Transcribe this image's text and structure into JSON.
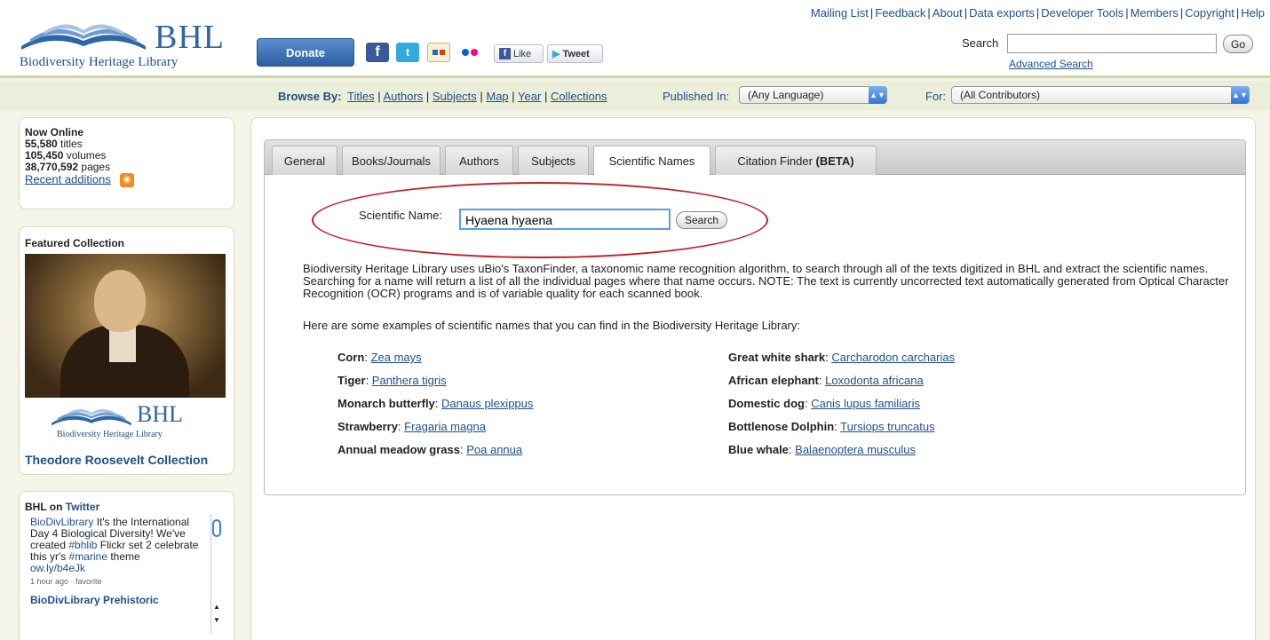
{
  "header": {
    "logo_name": "BHL",
    "logo_sub": "Biodiversity Heritage Library",
    "donate_label": "Donate",
    "like_label": "Like",
    "tweet_label": "Tweet",
    "top_links": [
      "Mailing List",
      "Feedback",
      "About",
      "Data exports",
      "Developer Tools",
      "Members",
      "Copyright",
      "Help"
    ],
    "search_label": "Search",
    "search_value": "",
    "go_label": "Go",
    "advanced_search": "Advanced Search",
    "colors": {
      "brand_blue": "#2d66a5",
      "facebook": "#3b5998",
      "twitter": "#33aadd",
      "flickr_pink": "#ff0084",
      "flickr_blue": "#0063dc"
    }
  },
  "browse": {
    "label": "Browse By:",
    "links": [
      "Titles",
      "Authors",
      "Subjects",
      "Map",
      "Year",
      "Collections"
    ],
    "published_label": "Published In:",
    "language_selected": "(Any Language)",
    "for_label": "For:",
    "contributor_selected": "(All Contributors)"
  },
  "sidebar": {
    "now_online": {
      "title": "Now Online",
      "titles_count": "55,580",
      "titles_word": "titles",
      "volumes_count": "105,450",
      "volumes_word": "volumes",
      "pages_count": "38,770,592",
      "pages_word": "pages",
      "recent_label": "Recent additions"
    },
    "featured": {
      "title": "Featured Collection",
      "collection_name": "Theodore Roosevelt Collection",
      "logo_name": "BHL",
      "logo_sub": "Biodiversity Heritage Library"
    },
    "twitter": {
      "title_prefix": "BHL on",
      "title_link": "Twitter",
      "tweet_user": "BioDivLibrary",
      "tweet_text_1": "It's the International Day 4 Biological Diversity! We've created",
      "tweet_hashtag_1": "#bhlib",
      "tweet_text_2": "Flickr set 2 celebrate this yr's",
      "tweet_hashtag_2": "#marine",
      "tweet_text_3": "theme",
      "tweet_link": "ow.ly/b4eJk",
      "tweet_meta": "1 hour ago · favorite",
      "next_tweet_partial": "BioDivLibrary Prehistoric"
    }
  },
  "main": {
    "tabs": [
      "General",
      "Books/Journals",
      "Authors",
      "Subjects",
      "Scientific Names",
      "Citation Finder "
    ],
    "tab_beta": "(BETA)",
    "active_tab": "Scientific Names",
    "scientific_label": "Scientific Name:",
    "scientific_value": "Hyaena hyaena",
    "search_button": "Search",
    "description": "Biodiversity Heritage Library uses uBio's TaxonFinder, a taxonomic name recognition algorithm, to search through all of the texts digitized in BHL and extract the scientific names. Searching for a name will return a list of all the individual pages where that name occurs. NOTE: The text is currently uncorrected text automatically generated from Optical Character Recognition (OCR) programs and is of variable quality for each scanned book.",
    "examples_intro": "Here are some examples of scientific names that you can find in the Biodiversity Heritage Library:",
    "examples_left": [
      {
        "common": "Corn",
        "sci": "Zea mays"
      },
      {
        "common": "Tiger",
        "sci": "Panthera tigris"
      },
      {
        "common": "Monarch butterfly",
        "sci": "Danaus plexippus"
      },
      {
        "common": "Strawberry",
        "sci": "Fragaria magna"
      },
      {
        "common": "Annual meadow grass",
        "sci": "Poa annua"
      }
    ],
    "examples_right": [
      {
        "common": "Great white shark",
        "sci": "Carcharodon carcharias"
      },
      {
        "common": "African elephant",
        "sci": "Loxodonta africana"
      },
      {
        "common": "Domestic dog",
        "sci": "Canis lupus familiaris"
      },
      {
        "common": "Bottlenose Dolphin",
        "sci": "Tursiops truncatus"
      },
      {
        "common": "Blue whale",
        "sci": "Balaenoptera musculus"
      }
    ],
    "highlight_color": "#c0202a"
  }
}
